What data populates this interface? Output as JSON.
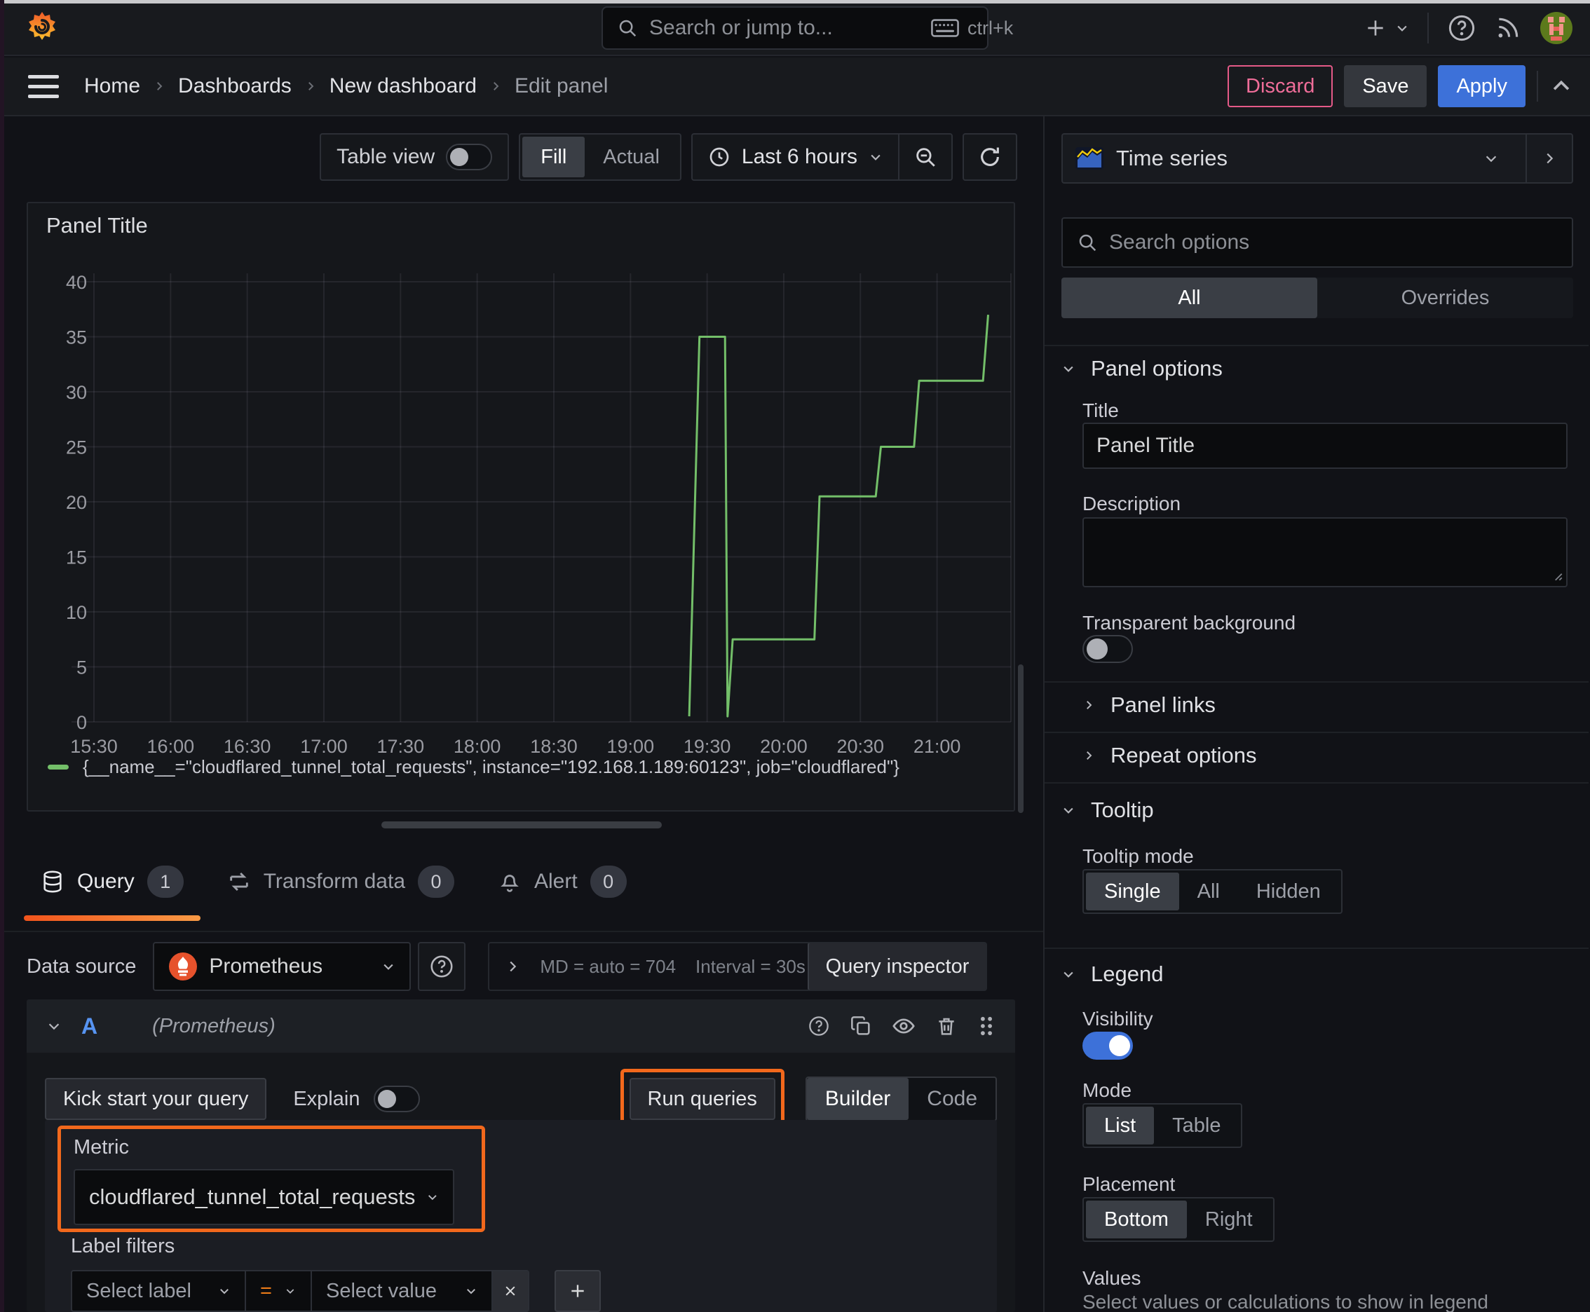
{
  "topbar": {
    "search_placeholder": "Search or jump to...",
    "shortcut": "ctrl+k"
  },
  "breadcrumb": {
    "items": [
      "Home",
      "Dashboards",
      "New dashboard",
      "Edit panel"
    ]
  },
  "actions": {
    "discard": "Discard",
    "save": "Save",
    "apply": "Apply"
  },
  "panel_toolbar": {
    "table_view": "Table view",
    "fill": "Fill",
    "actual": "Actual",
    "time_range": "Last 6 hours"
  },
  "viz_picker": {
    "label": "Time series"
  },
  "options_pane": {
    "search_placeholder": "Search options",
    "tabs": {
      "all": "All",
      "overrides": "Overrides"
    },
    "panel_options": {
      "header": "Panel options",
      "title_label": "Title",
      "title_value": "Panel Title",
      "description_label": "Description",
      "transparent_label": "Transparent background"
    },
    "collapsed": {
      "panel_links": "Panel links",
      "repeat_options": "Repeat options"
    },
    "tooltip": {
      "header": "Tooltip",
      "mode_label": "Tooltip mode",
      "modes": [
        "Single",
        "All",
        "Hidden"
      ]
    },
    "legend": {
      "header": "Legend",
      "visibility_label": "Visibility",
      "mode_label": "Mode",
      "modes": [
        "List",
        "Table"
      ],
      "placement_label": "Placement",
      "placements": [
        "Bottom",
        "Right"
      ],
      "values_label": "Values",
      "values_hint": "Select values or calculations to show in legend"
    }
  },
  "query_pane": {
    "tabs": [
      {
        "label": "Query",
        "count": "1"
      },
      {
        "label": "Transform data",
        "count": "0"
      },
      {
        "label": "Alert",
        "count": "0"
      }
    ],
    "datasource": {
      "label": "Data source",
      "name": "Prometheus",
      "stats_md": "MD = auto = 704",
      "stats_interval": "Interval = 30s",
      "inspector": "Query inspector"
    },
    "query_row": {
      "ref": "A",
      "datasource_hint": "(Prometheus)"
    },
    "editor": {
      "kickstart": "Kick start your query",
      "explain": "Explain",
      "run": "Run queries",
      "builder": "Builder",
      "code": "Code",
      "metric_label": "Metric",
      "metric_value": "cloudflared_tunnel_total_requests",
      "label_filters_label": "Label filters",
      "select_label": "Select label",
      "operator": "=",
      "select_value": "Select value"
    }
  },
  "chart_data": {
    "type": "line",
    "title": "Panel Title",
    "xlabel": "",
    "ylabel": "",
    "x_ticks": [
      "15:30",
      "16:00",
      "16:30",
      "17:00",
      "17:30",
      "18:00",
      "18:30",
      "19:00",
      "19:30",
      "20:00",
      "20:30",
      "21:00"
    ],
    "y_ticks": [
      0,
      5,
      10,
      15,
      20,
      25,
      30,
      35,
      40
    ],
    "ylim": [
      0,
      40
    ],
    "grid": true,
    "legend_position": "bottom",
    "series": [
      {
        "name": "{__name__=\"cloudflared_tunnel_total_requests\", instance=\"192.168.1.189:60123\", job=\"cloudflared\"}",
        "color": "#73bf69",
        "x_unit": "minutes since 15:30",
        "points": [
          [
            233,
            0.5
          ],
          [
            237,
            35
          ],
          [
            247,
            35
          ],
          [
            248,
            0.5
          ],
          [
            250,
            7.5
          ],
          [
            282,
            7.5
          ],
          [
            284,
            20.5
          ],
          [
            306,
            20.5
          ],
          [
            308,
            25
          ],
          [
            321,
            25
          ],
          [
            323,
            31
          ],
          [
            348,
            31
          ],
          [
            350,
            37
          ]
        ]
      }
    ]
  }
}
